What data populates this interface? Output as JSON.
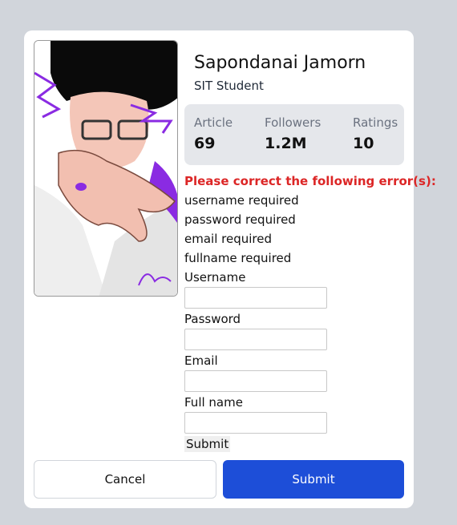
{
  "profile": {
    "name": "Sapondanai Jamorn",
    "role": "SIT Student",
    "photo_icon": "profile-illustration"
  },
  "stats": [
    {
      "label": "Article",
      "value": "69"
    },
    {
      "label": "Followers",
      "value": "1.2M"
    },
    {
      "label": "Ratings",
      "value": "10"
    }
  ],
  "errors": {
    "title": "Please correct the following error(s):",
    "items": [
      "username required",
      "password required",
      "email required",
      "fullname required"
    ]
  },
  "form": {
    "username_label": "Username",
    "username_value": "",
    "password_label": "Password",
    "password_value": "",
    "email_label": "Email",
    "email_value": "",
    "fullname_label": "Full name",
    "fullname_value": "",
    "submit_label": "Submit"
  },
  "actions": {
    "cancel_label": "Cancel",
    "submit_label": "Submit"
  },
  "colors": {
    "page_bg": "#d1d5db",
    "error": "#dc2626",
    "primary": "#1d4ed8",
    "stats_bg": "#e5e7eb"
  }
}
